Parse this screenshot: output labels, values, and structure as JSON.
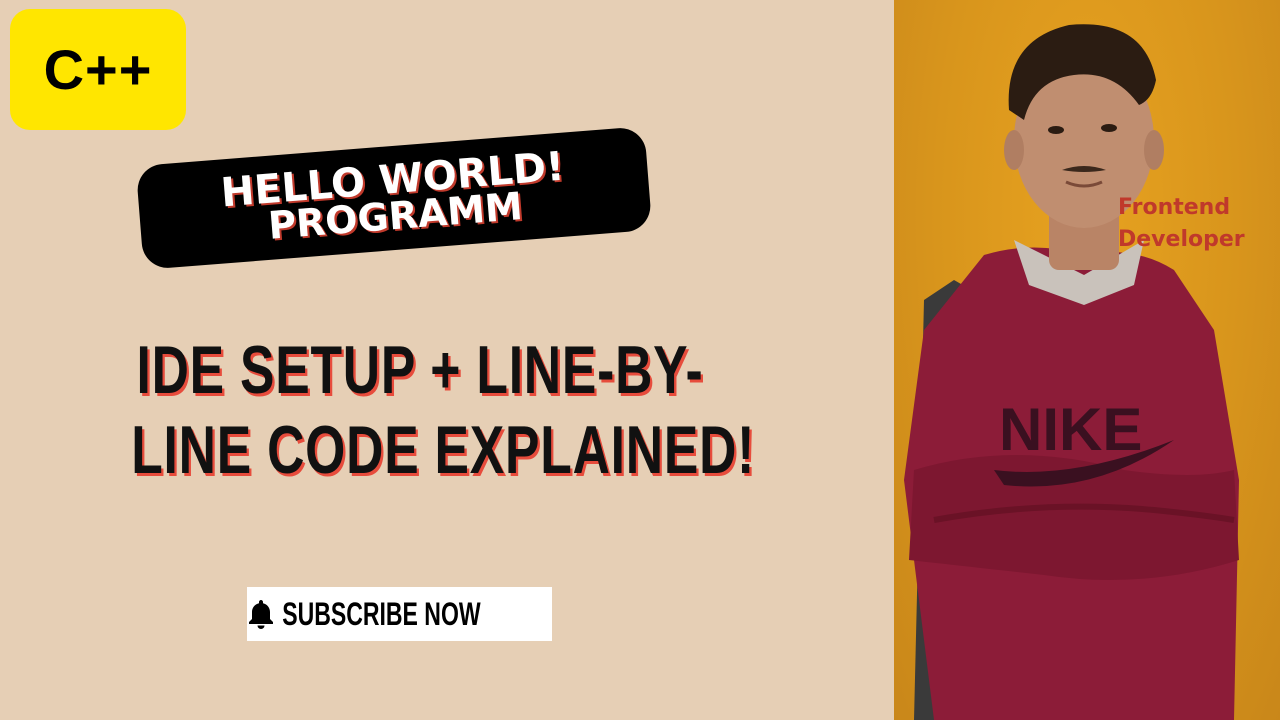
{
  "badge": {
    "label": "C++",
    "color": "#ffe600"
  },
  "banner": {
    "line1": "HELLO WORLD!",
    "line2": "PROGRAMM"
  },
  "headline": {
    "line1": "IDE SETUP + LINE-BY-",
    "line2": "LINE CODE EXPLAINED!"
  },
  "subscribe": {
    "icon": "bell-icon",
    "label": "SUBSCRIBE NOW"
  },
  "photo": {
    "caption_line1": "Frontend",
    "caption_line2": "Developer",
    "shirt_text": "NIKE",
    "background_color": "#d8951c",
    "shirt_color": "#8c1c38"
  },
  "colors": {
    "page_background": "#e6cfb5",
    "accent_red": "#c0392b"
  }
}
